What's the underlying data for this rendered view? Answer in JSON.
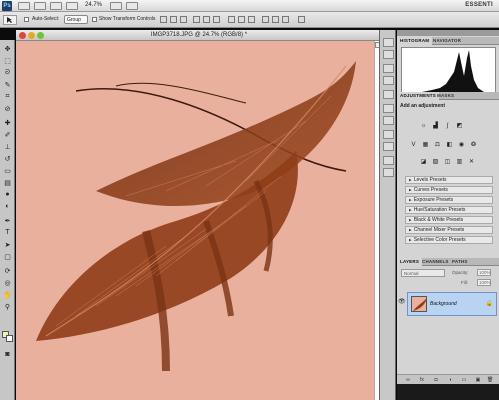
{
  "menubar": {
    "app_icon": "Ps",
    "zoom": "24.7%",
    "workspace": "ESSENTI"
  },
  "options": {
    "auto_select_label": "Auto-Select:",
    "auto_select_value": "Group",
    "transform_label": "Show Transform Controls"
  },
  "document": {
    "title": "IMGP3718.JPG @ 24.7% (RGB/8) *",
    "canvas_color": "#eab09e",
    "feather_color": "#8a3a18"
  },
  "panels": {
    "histogram_tab": "HISTOGRAM",
    "navigator_tab": "NAVIGATOR",
    "adjustments_tab": "ADJUSTMENTS",
    "masks_tab": "MASKS",
    "adjustments_label": "Add an adjustment",
    "presets": [
      "Levels Presets",
      "Curves Presets",
      "Exposure Presets",
      "Hue/Saturation Presets",
      "Black & White Presets",
      "Channel Mixer Presets",
      "Selective Color Presets"
    ],
    "layers_tab": "LAYERS",
    "channels_tab": "CHANNELS",
    "paths_tab": "PATHS",
    "blend_mode": "Normal",
    "opacity_label": "Opacity:",
    "opacity_value": "100%",
    "fill_label": "Fill:",
    "fill_value": "100%",
    "layer_name": "Background"
  }
}
